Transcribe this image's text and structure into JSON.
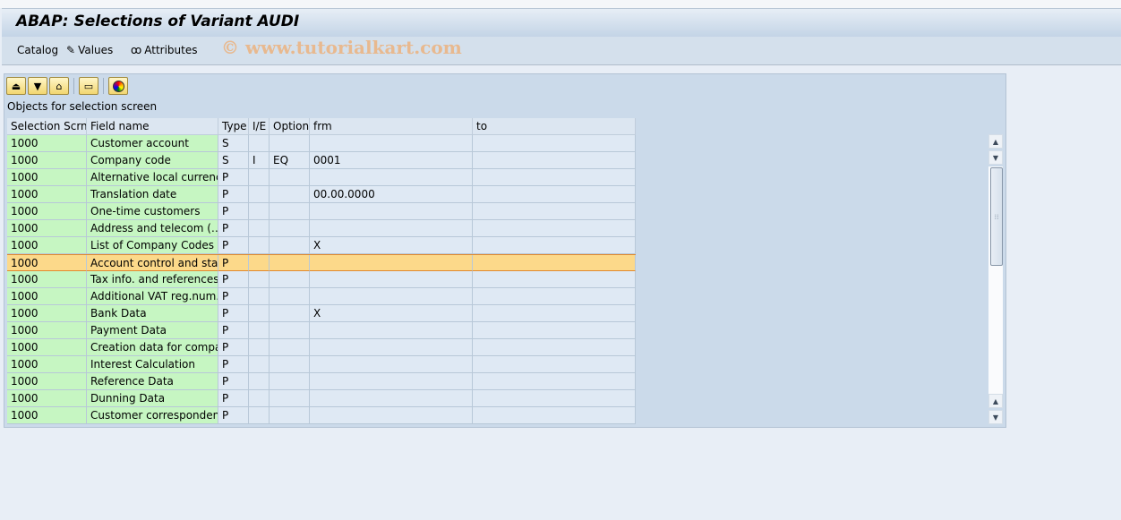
{
  "title": "ABAP: Selections of Variant AUDI",
  "menu": {
    "catalog": "Catalog",
    "values": "Values",
    "attributes": "Attributes"
  },
  "watermark": "© www.tutorialkart.com",
  "toolbar": [
    "print-icon",
    "filter-icon",
    "find-icon",
    "page-icon",
    "color-legend-icon"
  ],
  "caption": "Objects for selection screen",
  "columns": [
    "Selection Scrns",
    "Field name",
    "Type",
    "I/E",
    "Option",
    "frm",
    "to"
  ],
  "rows": [
    [
      "1000",
      "Customer account",
      "S",
      "",
      "",
      "",
      ""
    ],
    [
      "1000",
      "Company code",
      "S",
      "I",
      "EQ",
      "0001",
      ""
    ],
    [
      "1000",
      "Alternative local currency",
      "P",
      "",
      "",
      "",
      ""
    ],
    [
      "1000",
      "Translation date",
      "P",
      "",
      "",
      "00.00.0000",
      ""
    ],
    [
      "1000",
      "One-time customers",
      "P",
      "",
      "",
      "",
      ""
    ],
    [
      "1000",
      "Address and telecom (…",
      "P",
      "",
      "",
      "",
      ""
    ],
    [
      "1000",
      "List of Company Codes",
      "P",
      "",
      "",
      "X",
      ""
    ],
    [
      "1000",
      "Account control and sta…",
      "P",
      "",
      "",
      "",
      ""
    ],
    [
      "1000",
      "Tax info. and references",
      "P",
      "",
      "",
      "",
      ""
    ],
    [
      "1000",
      "Additional VAT reg.num…",
      "P",
      "",
      "",
      "",
      ""
    ],
    [
      "1000",
      "Bank Data",
      "P",
      "",
      "",
      "X",
      ""
    ],
    [
      "1000",
      "Payment Data",
      "P",
      "",
      "",
      "",
      ""
    ],
    [
      "1000",
      "Creation data for compa…",
      "P",
      "",
      "",
      "",
      ""
    ],
    [
      "1000",
      "Interest Calculation",
      "P",
      "",
      "",
      "",
      ""
    ],
    [
      "1000",
      "Reference Data",
      "P",
      "",
      "",
      "",
      ""
    ],
    [
      "1000",
      "Dunning Data",
      "P",
      "",
      "",
      "",
      ""
    ],
    [
      "1000",
      "Customer corresponden…",
      "P",
      "",
      "",
      "",
      ""
    ]
  ],
  "selected_row": 7,
  "colors": {
    "key_cell": "#c6f6c2",
    "selected_row": "#fcd98a",
    "selected_border": "#e0892f"
  }
}
